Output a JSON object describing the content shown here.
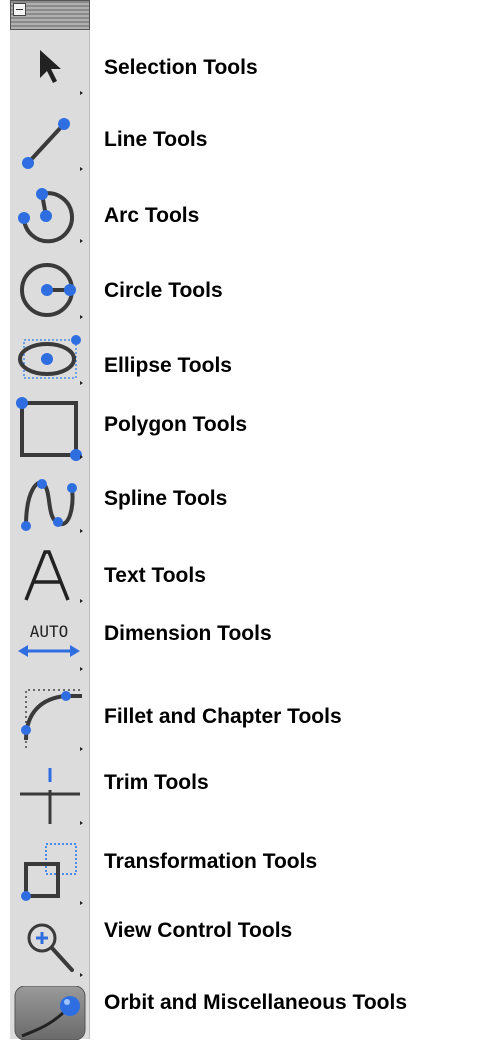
{
  "palette": {
    "tools": [
      {
        "label": "Selection Tools",
        "icon": "arrow-icon"
      },
      {
        "label": "Line Tools",
        "icon": "line-icon"
      },
      {
        "label": "Arc Tools",
        "icon": "arc-icon"
      },
      {
        "label": "Circle Tools",
        "icon": "circle-icon"
      },
      {
        "label": "Ellipse Tools",
        "icon": "ellipse-icon"
      },
      {
        "label": "Polygon Tools",
        "icon": "polygon-icon"
      },
      {
        "label": "Spline Tools",
        "icon": "spline-icon"
      },
      {
        "label": "Text Tools",
        "icon": "text-icon"
      },
      {
        "label": "Dimension Tools",
        "icon": "dimension-icon",
        "icon_text": "AUTO"
      },
      {
        "label": "Fillet and Chapter Tools",
        "icon": "fillet-icon"
      },
      {
        "label": "Trim Tools",
        "icon": "trim-icon"
      },
      {
        "label": "Transformation Tools",
        "icon": "transformation-icon"
      },
      {
        "label": "View Control Tools",
        "icon": "zoom-icon"
      },
      {
        "label": "Orbit and Miscellaneous Tools",
        "icon": "orbit-icon"
      }
    ]
  },
  "colors": {
    "handle": "#2f6ee0",
    "stroke": "#3a3a3a",
    "palette": "#dcdcdc"
  }
}
